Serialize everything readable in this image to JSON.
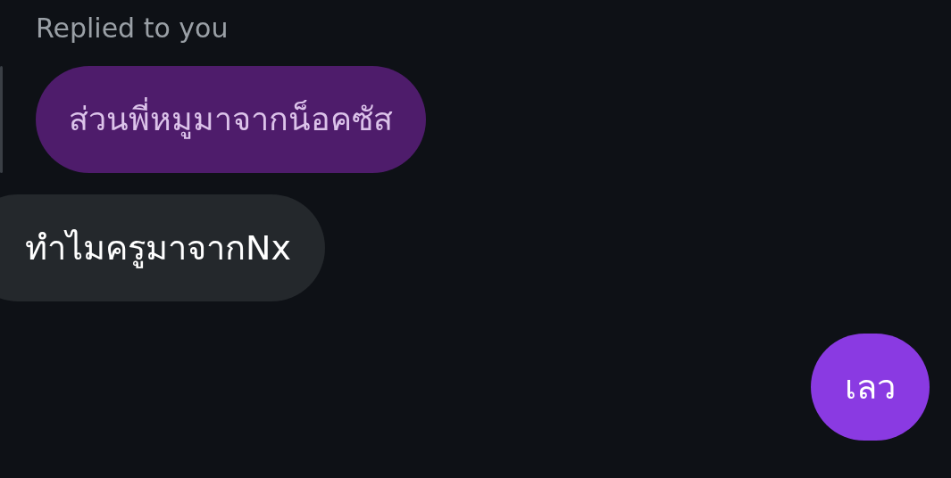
{
  "reply_header": {
    "text": "Replied to you"
  },
  "messages": [
    {
      "kind": "quoted",
      "text": "ส่วนพี่หมูมาจากน็อคซัส"
    },
    {
      "kind": "received",
      "text": "ทำไมครูมาจากNx"
    },
    {
      "kind": "sent",
      "text": "เลว"
    }
  ]
}
